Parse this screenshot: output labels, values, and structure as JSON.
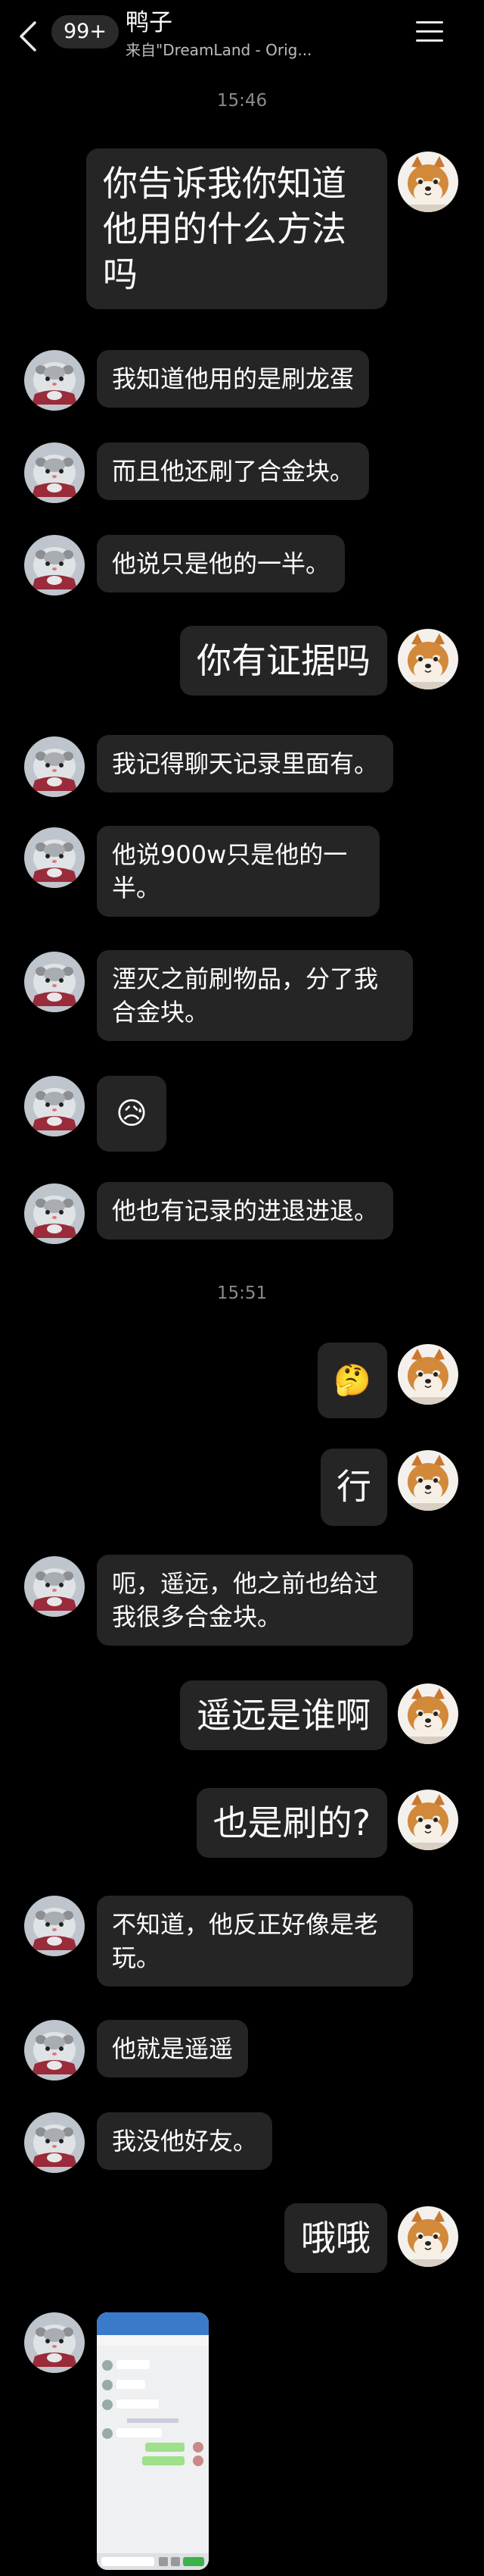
{
  "header": {
    "unread_badge": "99+",
    "title": "鸭子",
    "subtitle": "来自\"DreamLand - Orig..."
  },
  "timestamps": [
    "15:46",
    "15:51"
  ],
  "messages": [
    {
      "side": "right",
      "text": "你告诉我你知道他用的什么方法吗"
    },
    {
      "side": "left",
      "text": "我知道他用的是刷龙蛋"
    },
    {
      "side": "left",
      "text": "而且他还刷了合金块。"
    },
    {
      "side": "left",
      "text": "他说只是他的一半。"
    },
    {
      "side": "right",
      "text": "你有证据吗"
    },
    {
      "side": "left",
      "text": "我记得聊天记录里面有。"
    },
    {
      "side": "left",
      "text": "他说900w只是他的一半。"
    },
    {
      "side": "left",
      "text": "湮灭之前刷物品，分了我合金块。"
    },
    {
      "side": "left",
      "emoji": "😥"
    },
    {
      "side": "left",
      "text": "他也有记录的进退进退。"
    },
    {
      "side": "right",
      "emoji": "🤔"
    },
    {
      "side": "right",
      "text": "行"
    },
    {
      "side": "left",
      "text": "呃，遥远，他之前也给过我很多合金块。"
    },
    {
      "side": "right",
      "text": "遥远是谁啊"
    },
    {
      "side": "right",
      "text": "也是刷的?"
    },
    {
      "side": "left",
      "text": "不知道，他反正好像是老玩。"
    },
    {
      "side": "left",
      "text": "他就是遥遥"
    },
    {
      "side": "left",
      "text": "我没他好友。"
    },
    {
      "side": "right",
      "text": "哦哦"
    },
    {
      "side": "left",
      "image": "chat-screenshot"
    }
  ],
  "icons": {
    "back": "chevron-left-icon",
    "menu": "hamburger-menu-icon",
    "self_avatar": "shiba-dog-avatar",
    "contact_avatar": "hamster-avatar"
  },
  "colors": {
    "background": "#000000",
    "bubble": "#252525",
    "subtext": "#8a8a8a"
  }
}
